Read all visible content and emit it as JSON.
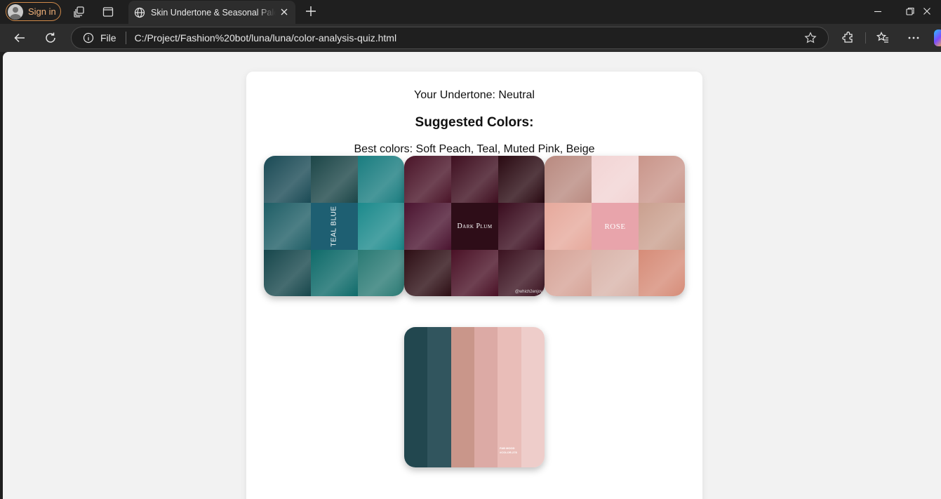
{
  "browser": {
    "sign_in_label": "Sign in",
    "tab_title": "Skin Undertone & Seasonal Palette",
    "address_scheme": "File",
    "address_url": "C:/Project/Fashion%20bot/luna/luna/color-analysis-quiz.html"
  },
  "page": {
    "undertone_text": "Your Undertone: Neutral",
    "suggested_heading": "Suggested Colors:",
    "best_colors_text": "Best colors: Soft Peach, Teal, Muted Pink, Beige"
  },
  "swatches": [
    {
      "label": "TEAL BLUE",
      "cells": [
        "#1a4a55",
        "#1c4648",
        "#1a7d80",
        "#1f5e66",
        "#1e5f72",
        "#1c8a8c",
        "#17474c",
        "#0f6b6a",
        "#2a7a74"
      ]
    },
    {
      "label": "Dark Plum",
      "cells": [
        "#4a1428",
        "#3f0f20",
        "#2a0a12",
        "#4b1430",
        "#2e0d18",
        "#3a0c1e",
        "#2d0e14",
        "#4a1126",
        "#3b1220"
      ]
    },
    {
      "label": "ROSE",
      "cells": [
        "#b98a80",
        "#f2d4d4",
        "#c9958a",
        "#e6a99c",
        "#e8a4ab",
        "#caa08f",
        "#d6a397",
        "#d9b4aa",
        "#d68c78"
      ]
    }
  ],
  "palette": {
    "colors": [
      "#22474f",
      "#31555e",
      "#c9968a",
      "#dcaaa5",
      "#e9bdb8",
      "#eecdca"
    ],
    "tag_line1": "FAB MOOD",
    "tag_line2": "#COLOR-278"
  },
  "watermark": "@which2enjoy"
}
